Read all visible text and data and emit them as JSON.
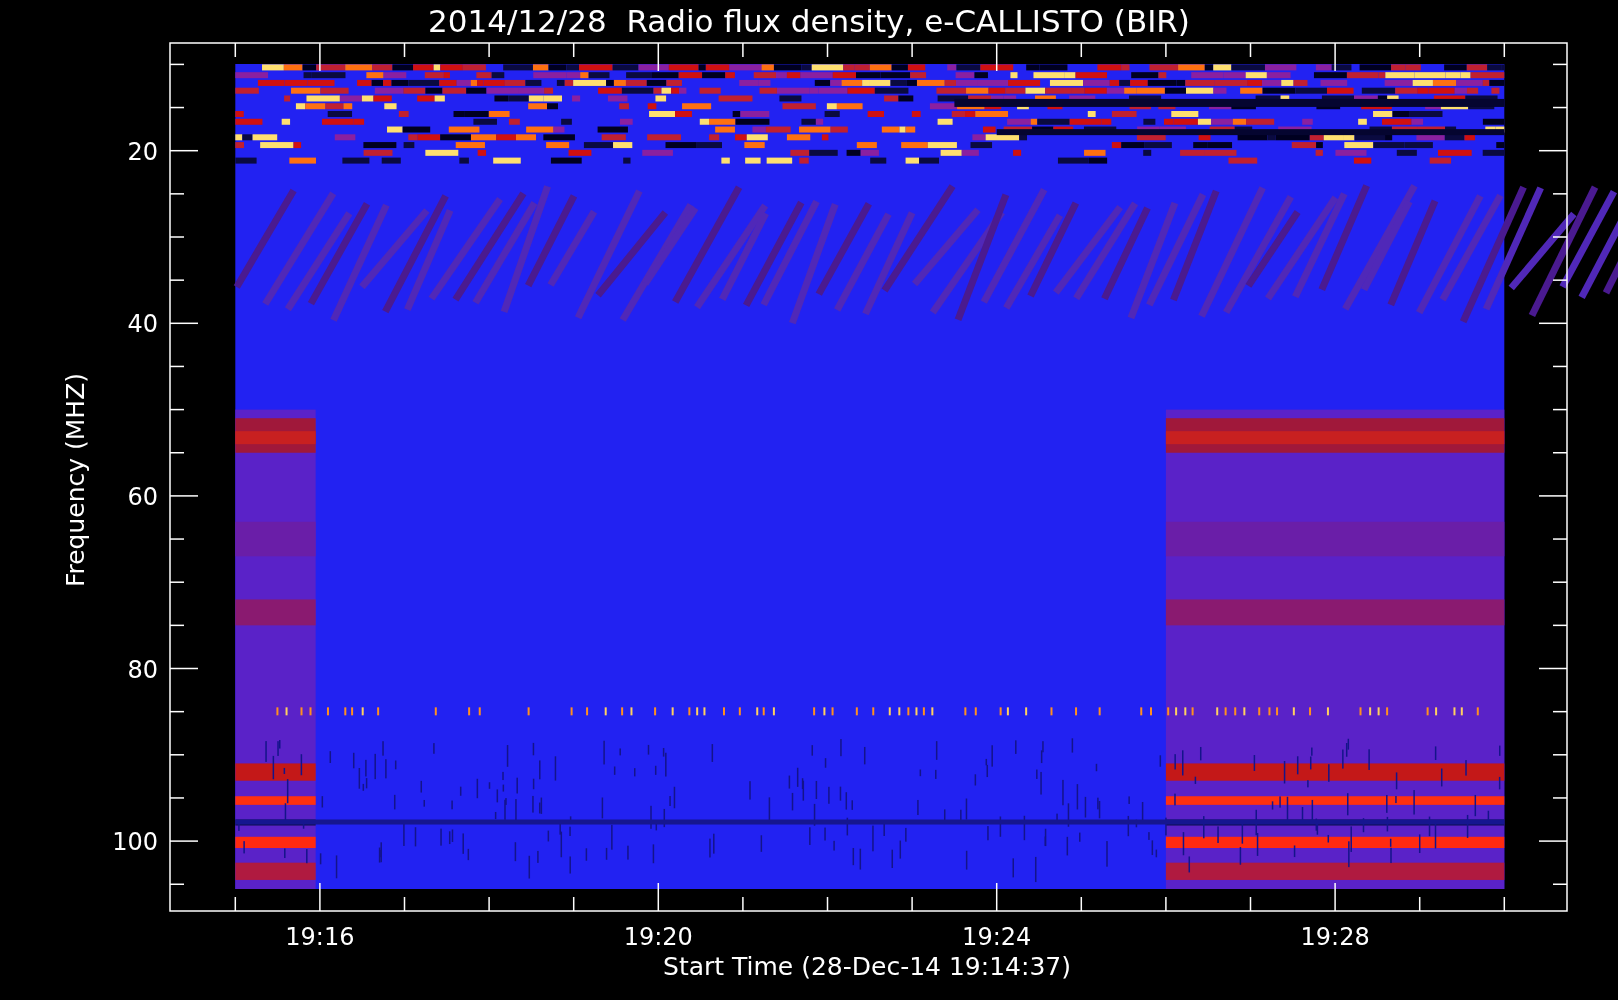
{
  "title": "2014/12/28  Radio flux density, e-CALLISTO (BIR)",
  "y_axis": {
    "label": "Frequency (MHZ)",
    "tick_labels": [
      "20",
      "40",
      "60",
      "80",
      "100"
    ]
  },
  "x_axis": {
    "label": "Start Time (28-Dec-14 19:14:37)",
    "tick_labels": [
      "19:16",
      "19:20",
      "19:24",
      "19:28"
    ]
  }
}
